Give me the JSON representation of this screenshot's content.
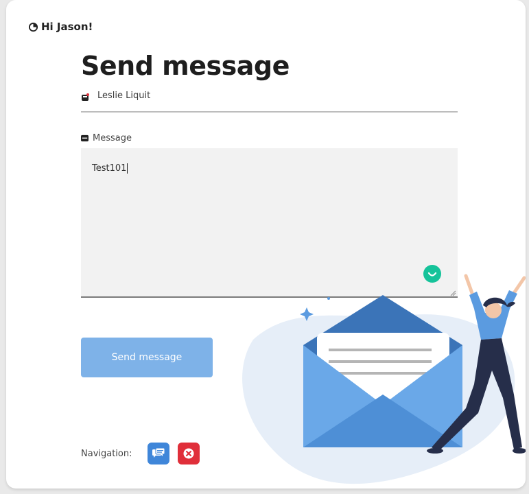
{
  "greeting": "Hi Jason!",
  "page_title": "Send message",
  "recipient": {
    "name": "Leslie Liquit"
  },
  "message": {
    "label": "Message",
    "value": "Test101"
  },
  "send_button_label": "Send message",
  "navigation": {
    "label": "Navigation:",
    "buttons": [
      {
        "icon": "chat-icon",
        "color": "#3f86d9"
      },
      {
        "icon": "close-circle-icon",
        "color": "#e02f3a"
      }
    ]
  },
  "colors": {
    "primary_button": "#7eb2e8",
    "grammarly": "#15c39a"
  }
}
